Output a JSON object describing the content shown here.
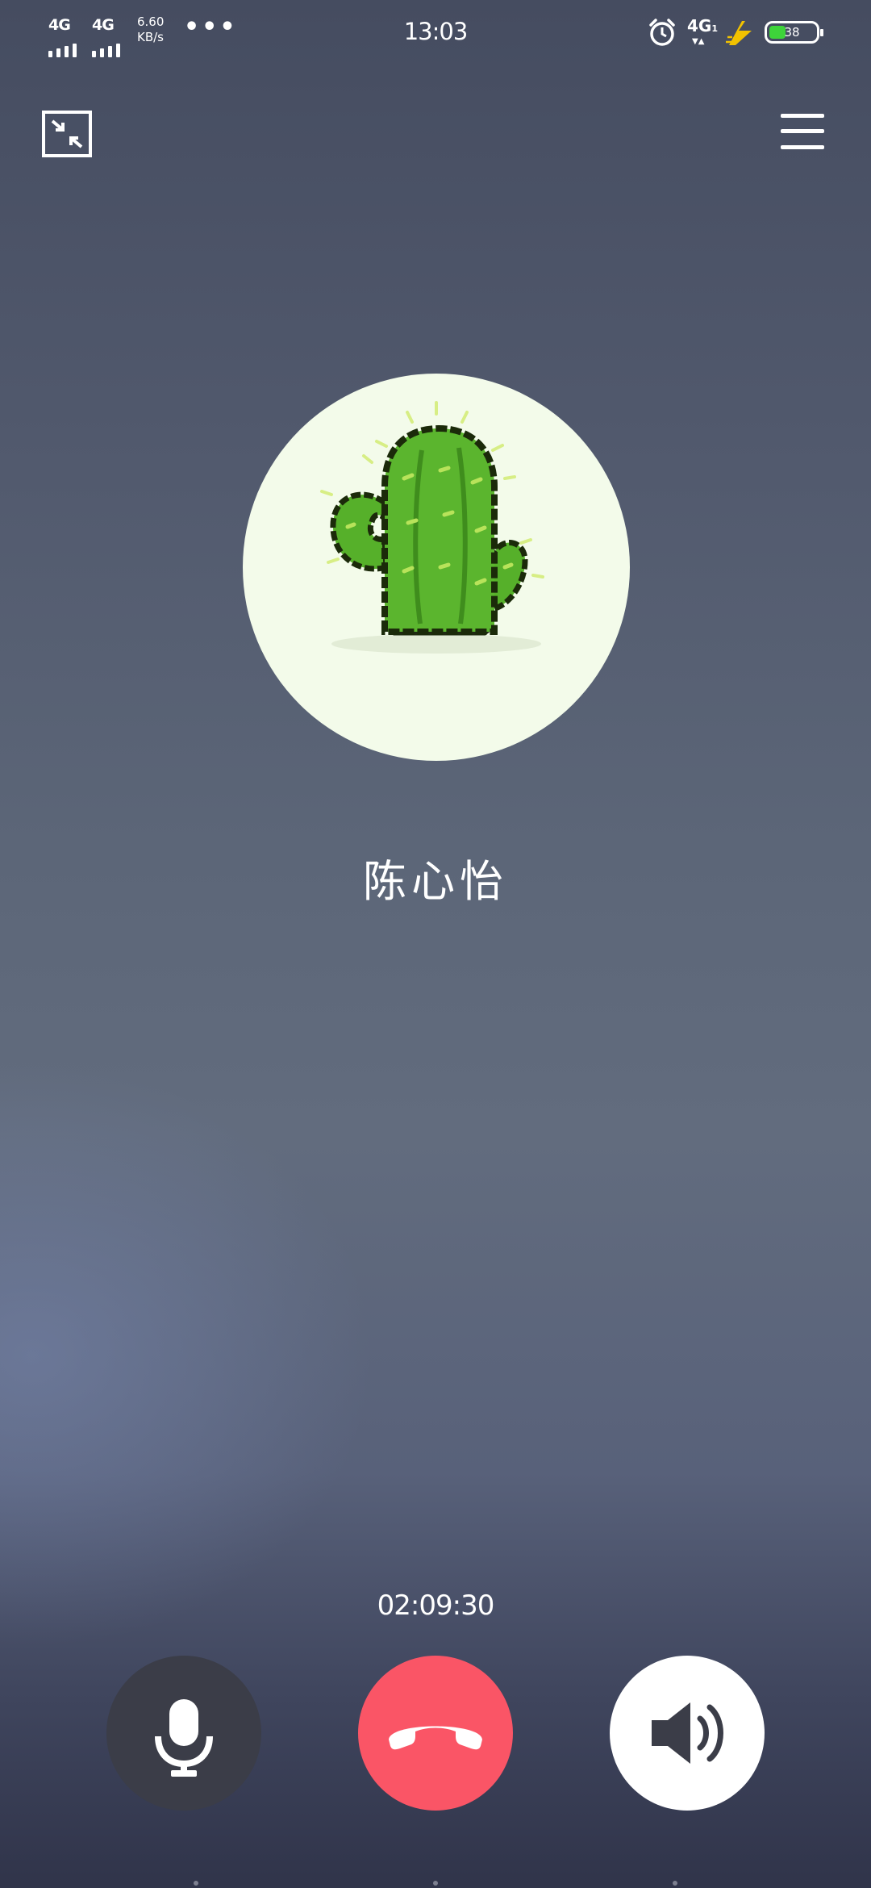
{
  "status_bar": {
    "sim1_network": "4G",
    "sim2_network": "4G",
    "net_speed_value": "6.60",
    "net_speed_unit": "KB/s",
    "more_dots": "•••",
    "time": "13:03",
    "right_network": "4G",
    "right_network_sub": "1",
    "right_network_arrows": "▼▲",
    "battery_level": "38",
    "icons": [
      "alarm-icon",
      "charging-bolt-icon",
      "battery-icon"
    ]
  },
  "toolbar": {
    "icons": [
      "minimize-window-icon",
      "menu-icon"
    ]
  },
  "caller": {
    "name": "陈心怡",
    "avatar_icon": "cactus-avatar"
  },
  "call": {
    "duration": "02:09:30",
    "buttons": [
      {
        "name": "mute",
        "icon": "microphone-icon",
        "color": "#3b3d48"
      },
      {
        "name": "hang-up",
        "icon": "phone-hangup-icon",
        "color": "#fa5566"
      },
      {
        "name": "speaker",
        "icon": "speaker-icon",
        "color": "#ffffff"
      }
    ]
  },
  "colors": {
    "background_top": "#454c60",
    "background_bottom": "#30344a",
    "battery_fill": "#3ed43a",
    "hangup_red": "#fa5566",
    "charge_bolt": "#f2c200"
  }
}
